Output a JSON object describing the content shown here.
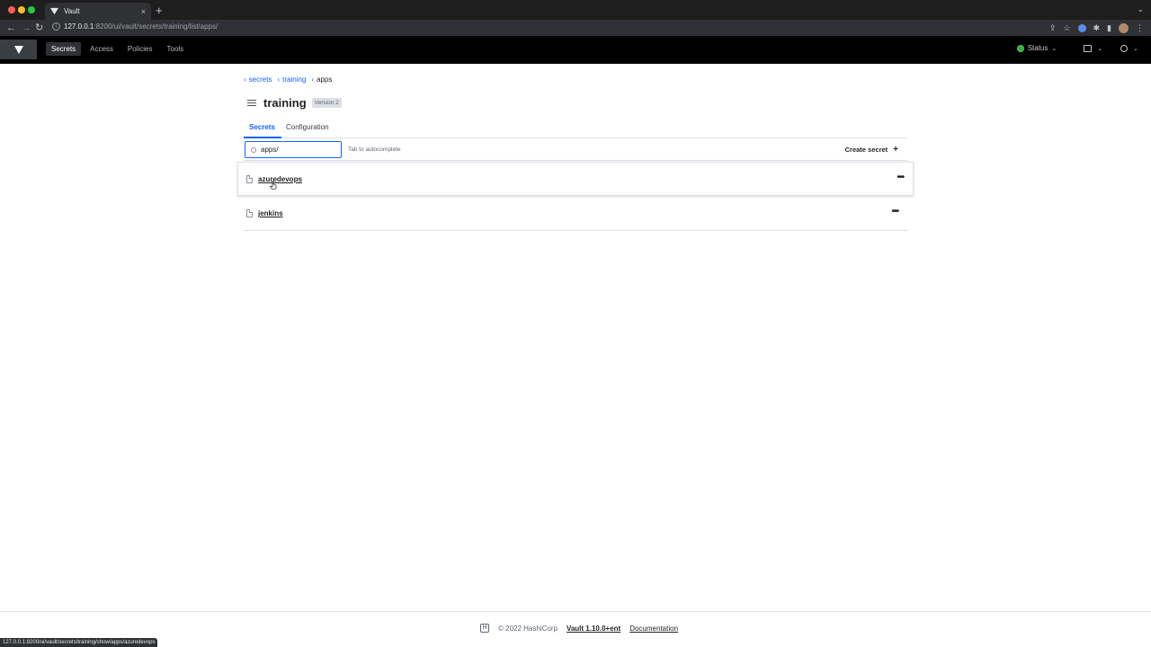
{
  "browser": {
    "tab_title": "Vault",
    "tab_close": "×",
    "new_tab": "+",
    "url_host": "127.0.0.1",
    "url_rest": ":8200/ui/vault/secrets/training/list/apps/",
    "status_url": "127.0.0.1:8200/ui/vault/secrets/training/show/apps/azuredevops"
  },
  "navbar": {
    "links": [
      "Secrets",
      "Access",
      "Policies",
      "Tools"
    ],
    "status_label": "Status",
    "status_color": "#2eb039"
  },
  "breadcrumb": {
    "items": [
      "secrets",
      "training"
    ],
    "current": "apps"
  },
  "page": {
    "title": "training",
    "version_tag": "Version 2"
  },
  "tabs": {
    "secrets": "Secrets",
    "configuration": "Configuration"
  },
  "toolbar": {
    "search_value": "apps/",
    "autocomplete_hint": "Tab to autocomplete",
    "create_label": "Create secret",
    "create_icon": "+"
  },
  "secrets": [
    {
      "name": "azuredevops",
      "menu": "•••"
    },
    {
      "name": "jenkins",
      "menu": "•••"
    }
  ],
  "footer": {
    "copyright": "© 2022 HashiCorp",
    "version": "Vault 1.10.0+ent",
    "docs": "Documentation"
  },
  "colors": {
    "accent": "#1563ff",
    "navbar_bg": "#000000"
  }
}
